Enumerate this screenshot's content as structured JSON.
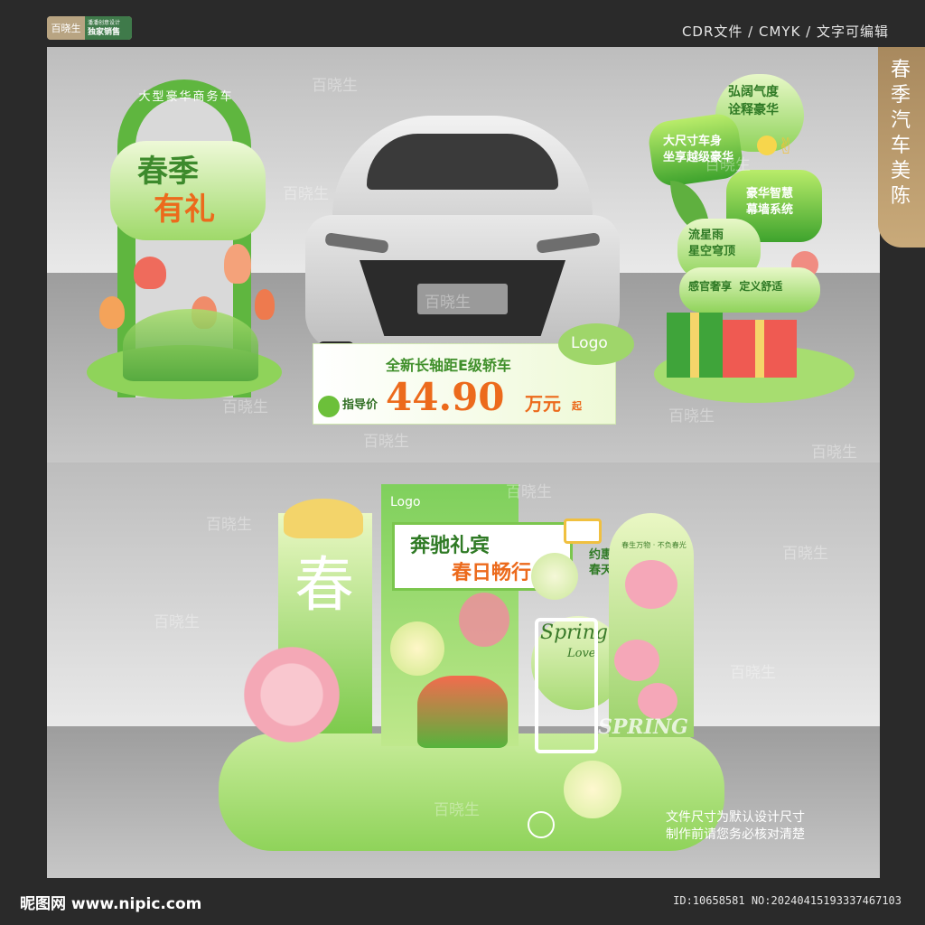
{
  "brand": {
    "name": "百晓生",
    "tagline": "潘潘创意设计",
    "badge": "独家销售"
  },
  "file_info": "CDR文件 / CMYK / 文字可编辑",
  "side_tag": "春季汽车美陈",
  "watermark": "百晓生",
  "panel1": {
    "arch_curve_text": "大型豪华商务车",
    "arch_title_line1": "春季",
    "arch_title_line2": "有礼",
    "price_board": {
      "headline": "全新长轴距E级轿车",
      "price_label": "指导价",
      "price": "44.90",
      "unit": "万元",
      "suffix": "起",
      "logo": "Logo"
    },
    "features": [
      {
        "l1": "弘阔气度",
        "l2": "诠释豪华"
      },
      {
        "l1": "大尺寸车身",
        "l2": "坐享越级豪华"
      },
      {
        "l1": "豪华智慧",
        "l2": "幕墙系统"
      },
      {
        "l1": "流星雨",
        "l2": "星空穹顶"
      },
      {
        "l1": "感官奢享",
        "l2": "定义舒适"
      }
    ]
  },
  "panel2": {
    "big_char": "春",
    "logo": "Logo",
    "board_line1": "奔驰礼宾",
    "board_line2": "春日畅行",
    "circle_text_l1": "约惠",
    "circle_text_l2": "春天",
    "spring_script": "Spring",
    "love_script": "Love",
    "arch_small": "春生万物 · 不负春光",
    "spring_word": "SPRING"
  },
  "note_line1": "文件尺寸为默认设计尺寸",
  "note_line2": "制作前请您务必核对清楚",
  "site": "昵图网 www.nipic.com",
  "id_line": "ID:10658581 NO:20240415193337467103"
}
